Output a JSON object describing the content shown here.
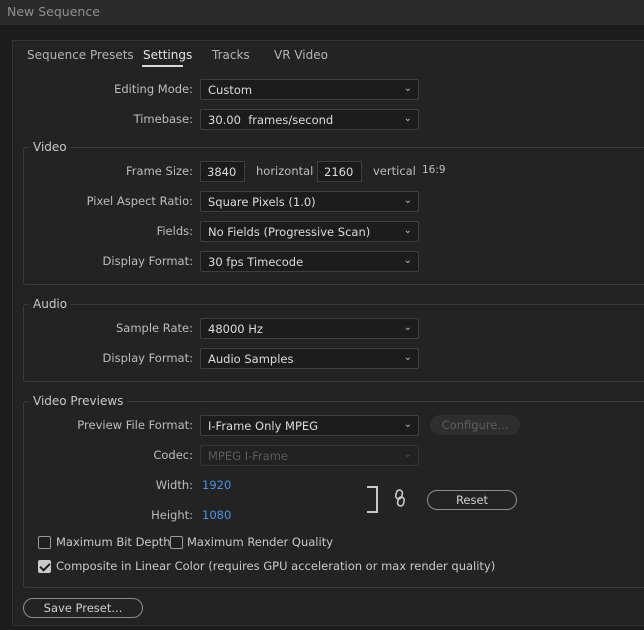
{
  "window": {
    "title": "New Sequence"
  },
  "tabs": [
    {
      "label": "Sequence Presets"
    },
    {
      "label": "Settings"
    },
    {
      "label": "Tracks"
    },
    {
      "label": "VR Video"
    }
  ],
  "general": {
    "editing_mode_label": "Editing Mode:",
    "editing_mode_value": "Custom",
    "timebase_label": "Timebase:",
    "timebase_value": "30.00  frames/second"
  },
  "video": {
    "title": "Video",
    "frame_size_label": "Frame Size:",
    "frame_width": "3840",
    "horizontal_label": "horizontal",
    "frame_height": "2160",
    "vertical_label": "vertical",
    "aspect": "16:9",
    "pixel_aspect_label": "Pixel Aspect Ratio:",
    "pixel_aspect_value": "Square Pixels (1.0)",
    "fields_label": "Fields:",
    "fields_value": "No Fields (Progressive Scan)",
    "display_format_label": "Display Format:",
    "display_format_value": "30 fps Timecode"
  },
  "audio": {
    "title": "Audio",
    "sample_rate_label": "Sample Rate:",
    "sample_rate_value": "48000 Hz",
    "display_format_label": "Display Format:",
    "display_format_value": "Audio Samples"
  },
  "previews": {
    "title": "Video Previews",
    "file_format_label": "Preview File Format:",
    "file_format_value": "I-Frame Only MPEG",
    "configure_label": "Configure...",
    "codec_label": "Codec:",
    "codec_value": "MPEG I-Frame",
    "width_label": "Width:",
    "width_value": "1920",
    "height_label": "Height:",
    "height_value": "1080",
    "reset_label": "Reset",
    "link_icon": "chain-link-icon"
  },
  "options": {
    "max_bit_depth": {
      "label": "Maximum Bit Depth",
      "checked": false
    },
    "max_render_quality": {
      "label": "Maximum Render Quality",
      "checked": false
    },
    "linear_color": {
      "label": "Composite in Linear Color (requires GPU acceleration or max render quality)",
      "checked": true
    }
  },
  "footer": {
    "save_preset_label": "Save Preset..."
  },
  "colors": {
    "link_blue": "#4b95e6",
    "background": "#232323"
  }
}
